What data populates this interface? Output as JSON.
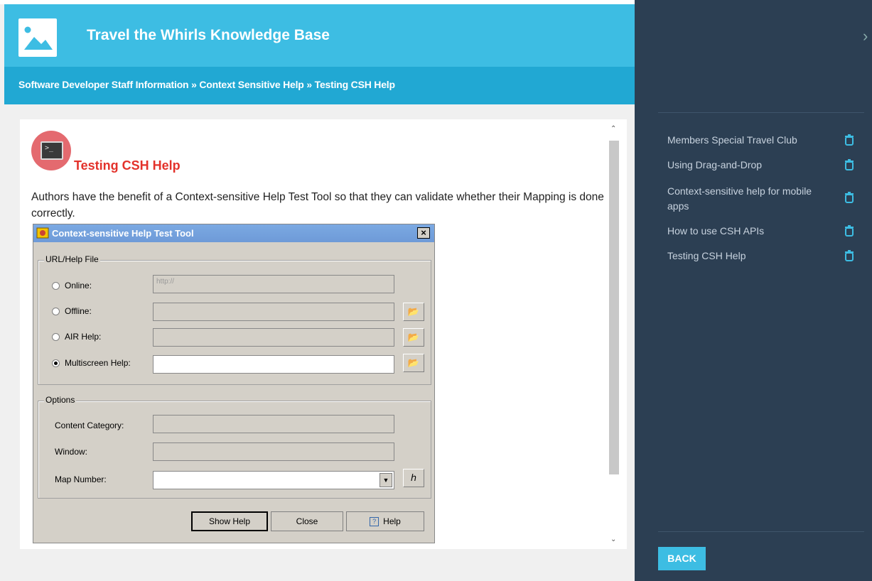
{
  "header": {
    "title": "Travel the Whirls Knowledge Base",
    "image_icon": "image-icon"
  },
  "breadcrumb": {
    "text": "Software Developer Staff Information » Context Sensitive Help » Testing CSH Help"
  },
  "topic": {
    "title": "Testing CSH Help",
    "icon": "terminal-icon",
    "paragraph": "Authors have the benefit of a Context-sensitive Help Test Tool so that they can validate whether their Mapping is done correctly."
  },
  "dialog": {
    "title": "Context-sensitive Help Test Tool",
    "close": "×",
    "url_group": "URL/Help File",
    "online": {
      "label": "Online:",
      "value": "http://"
    },
    "offline": {
      "label": "Offline:"
    },
    "air": {
      "label": "AIR Help:"
    },
    "multiscreen": {
      "label": "Multiscreen Help:"
    },
    "options_group": "Options",
    "content_category": "Content Category:",
    "window": "Window:",
    "map_number": "Map Number:",
    "buttons": {
      "show_help": "Show Help",
      "close": "Close",
      "help": "Help"
    }
  },
  "sidebar": {
    "items": [
      {
        "label": "Members Special Travel Club"
      },
      {
        "label": "Using Drag-and-Drop"
      },
      {
        "label": "Context-sensitive help for mobile apps"
      },
      {
        "label": "How to use CSH APIs"
      },
      {
        "label": "Testing CSH Help"
      }
    ],
    "back": "BACK",
    "close_icon": "chevron-right-icon"
  },
  "colors": {
    "header": "#3dbde3",
    "breadcrumb_bar": "#21a8d3",
    "sidebar": "#2c3f53",
    "topic_title": "#e3322b",
    "icon_circle": "#e46a6f"
  }
}
